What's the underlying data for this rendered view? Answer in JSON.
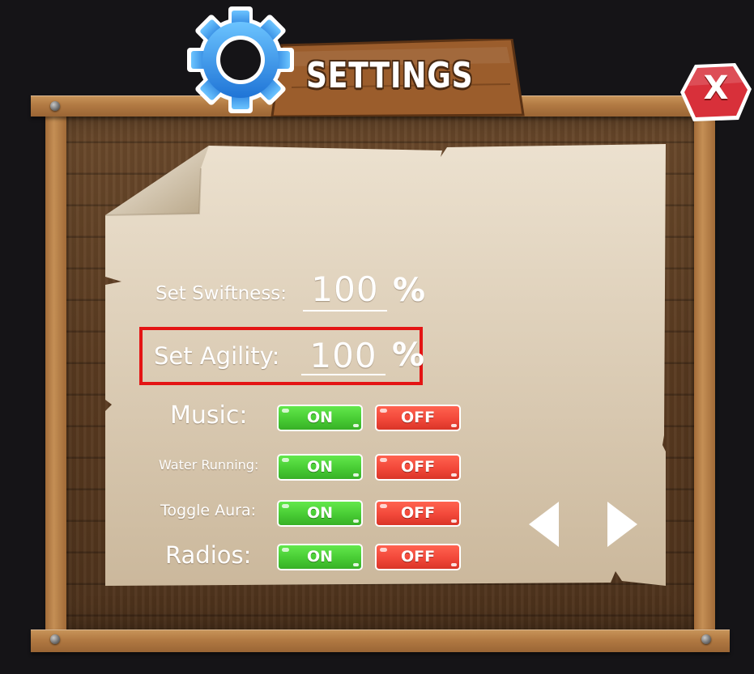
{
  "header": {
    "title": "SETTINGS",
    "close_label": "X"
  },
  "speed": {
    "swiftness_label": "Set Swiftness:",
    "swiftness_value": "100",
    "agility_label": "Set Agility:",
    "agility_value": "100",
    "percent_sign": "%"
  },
  "toggles": [
    {
      "label": "Music:",
      "on_label": "ON",
      "off_label": "OFF"
    },
    {
      "label": "Water Running:",
      "on_label": "ON",
      "off_label": "OFF"
    },
    {
      "label": "Toggle Aura:",
      "on_label": "ON",
      "off_label": "OFF"
    },
    {
      "label": "Radios:",
      "on_label": "ON",
      "off_label": "OFF"
    }
  ],
  "navigation": {
    "prev_icon": "triangle-left-icon",
    "next_icon": "triangle-right-icon"
  },
  "colors": {
    "on_green": "#48cc34",
    "off_red": "#f2483a",
    "highlight": "#e41414",
    "gear_blue": "#2f8fe6",
    "close_red": "#d8303a"
  }
}
